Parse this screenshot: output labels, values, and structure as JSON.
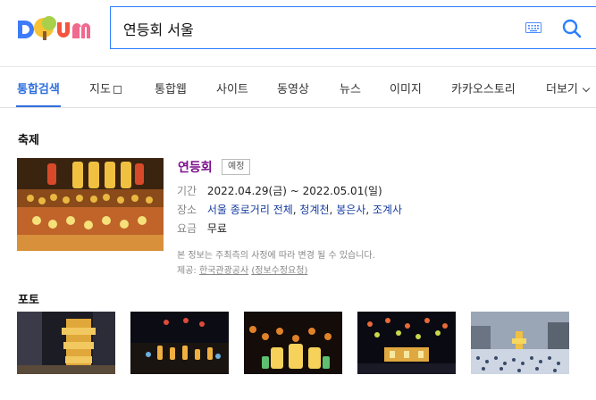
{
  "logo": {
    "text": "Daum"
  },
  "search": {
    "value": "연등회 서울"
  },
  "tabs": [
    {
      "label": "통합검색",
      "active": true
    },
    {
      "label": "지도"
    },
    {
      "label": "통합웹"
    },
    {
      "label": "사이트"
    },
    {
      "label": "동영상"
    },
    {
      "label": "뉴스"
    },
    {
      "label": "이미지"
    },
    {
      "label": "카카오스토리"
    },
    {
      "label": "더보기"
    }
  ],
  "festival": {
    "section_title": "축제",
    "name": "연등회",
    "badge": "예정",
    "period_label": "기간",
    "period": "2022.04.29(금) ~ 2022.05.01(일)",
    "place_label": "장소",
    "places": [
      "서울 종로거리 전체",
      "청계천",
      "봉은사",
      "조계사"
    ],
    "fee_label": "요금",
    "fee": "무료",
    "notice": "본 정보는 주최측의 사정에 따라 변경 될 수 있습니다.",
    "source_label": "제공:",
    "source_name": "한국관광공사",
    "source_request": "(정보수정요청)"
  },
  "photo": {
    "section_title": "포토"
  },
  "colors": {
    "accent": "#2f6fe0",
    "title_purple": "#7b0f8d",
    "link_blue": "#1a3fa0"
  }
}
